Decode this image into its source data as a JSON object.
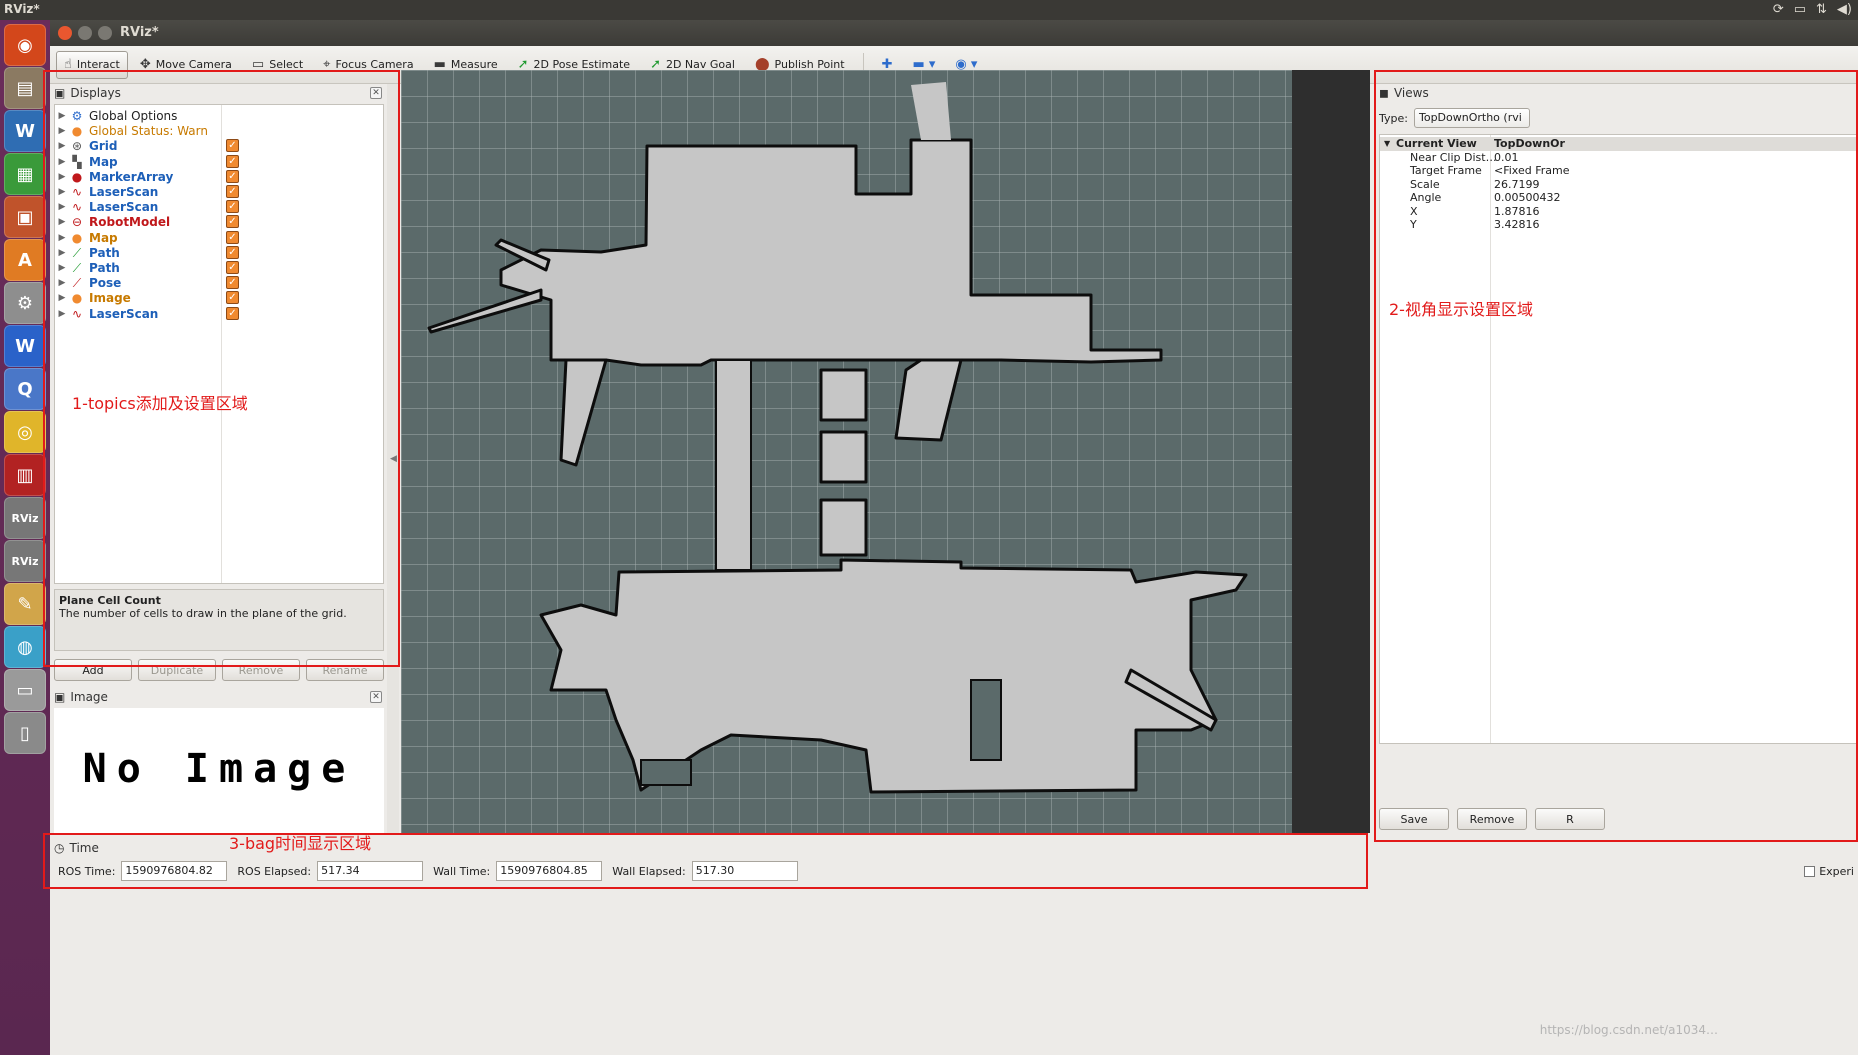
{
  "os": {
    "topbar_title": "RViz*",
    "tray": [
      "tray-update-icon",
      "tray-keyboard-icon",
      "tray-network-icon",
      "tray-volume-icon"
    ]
  },
  "launcher": [
    {
      "name": "ubuntu-dash-icon",
      "glyph": "◉",
      "color": "#d3471b"
    },
    {
      "name": "files-icon",
      "glyph": "▤",
      "color": "#8b7a62"
    },
    {
      "name": "writer-icon",
      "glyph": "W",
      "color": "#2f6db3"
    },
    {
      "name": "calc-icon",
      "glyph": "▦",
      "color": "#3a9a3a"
    },
    {
      "name": "impress-icon",
      "glyph": "▣",
      "color": "#c0532b"
    },
    {
      "name": "software-center-icon",
      "glyph": "A",
      "color": "#e07b23"
    },
    {
      "name": "settings-icon",
      "glyph": "⚙",
      "color": "#8e8e8e"
    },
    {
      "name": "wps-icon",
      "glyph": "W",
      "color": "#2a62c9"
    },
    {
      "name": "search-tool-icon",
      "glyph": "Q",
      "color": "#4a77c8"
    },
    {
      "name": "chrome-icon",
      "glyph": "◎",
      "color": "#e0b52a"
    },
    {
      "name": "media-icon",
      "glyph": "▥",
      "color": "#b22222"
    },
    {
      "name": "rviz-icon-1",
      "glyph": "RViz",
      "color": "#777"
    },
    {
      "name": "rviz-icon-2",
      "glyph": "RViz",
      "color": "#777"
    },
    {
      "name": "paint-icon",
      "glyph": "✎",
      "color": "#d1a54a"
    },
    {
      "name": "chat-icon",
      "glyph": "◍",
      "color": "#3aa0c8"
    },
    {
      "name": "drive-icon",
      "glyph": "▭",
      "color": "#9a9a9a"
    },
    {
      "name": "trash-icon",
      "glyph": "▯",
      "color": "#8a8a8a"
    }
  ],
  "window": {
    "title": "RViz*"
  },
  "toolbar": {
    "tools": [
      {
        "name": "interact",
        "label": "Interact",
        "icon": "hand-icon",
        "glyph": "☝",
        "active": true,
        "cls": ""
      },
      {
        "name": "move-camera",
        "label": "Move Camera",
        "icon": "move-icon",
        "glyph": "✥",
        "active": false,
        "cls": ""
      },
      {
        "name": "select",
        "label": "Select",
        "icon": "select-icon",
        "glyph": "▭",
        "active": false,
        "cls": ""
      },
      {
        "name": "focus-camera",
        "label": "Focus Camera",
        "icon": "focus-icon",
        "glyph": "⌖",
        "active": false,
        "cls": ""
      },
      {
        "name": "measure",
        "label": "Measure",
        "icon": "ruler-icon",
        "glyph": "▬",
        "active": false,
        "cls": ""
      },
      {
        "name": "2d-pose-estimate",
        "label": "2D Pose Estimate",
        "icon": "pose-arrow-icon",
        "glyph": "➚",
        "active": false,
        "cls": "green"
      },
      {
        "name": "2d-nav-goal",
        "label": "2D Nav Goal",
        "icon": "goal-arrow-icon",
        "glyph": "➚",
        "active": false,
        "cls": "green"
      },
      {
        "name": "publish-point",
        "label": "Publish Point",
        "icon": "pin-icon",
        "glyph": "⬤",
        "active": false,
        "cls": "brown"
      }
    ],
    "extra": [
      {
        "name": "add-tool-icon",
        "glyph": "✚"
      },
      {
        "name": "remove-tool-icon",
        "glyph": "▬ ▾"
      },
      {
        "name": "eye-icon",
        "glyph": "◉ ▾"
      }
    ]
  },
  "displays": {
    "title": "Displays",
    "items": [
      {
        "label": "Global Options",
        "cls": "plain",
        "icon": "gear-icon",
        "glyph": "⚙",
        "icolor": "#2d6ccc",
        "checked": false
      },
      {
        "label": "Global Status: Warn",
        "cls": "warn",
        "icon": "warning-icon",
        "glyph": "●",
        "icolor": "#f08a30",
        "checked": false
      },
      {
        "label": "Grid",
        "cls": "",
        "icon": "grid-icon",
        "glyph": "⊛",
        "icolor": "#555",
        "checked": true
      },
      {
        "label": "Map",
        "cls": "",
        "icon": "map-icon",
        "glyph": "▚",
        "icolor": "#555",
        "checked": true
      },
      {
        "label": "MarkerArray",
        "cls": "",
        "icon": "marker-icon",
        "glyph": "●",
        "icolor": "#c0181b",
        "checked": true
      },
      {
        "label": "LaserScan",
        "cls": "",
        "icon": "laser-icon",
        "glyph": "∿",
        "icolor": "#c0181b",
        "checked": true
      },
      {
        "label": "LaserScan",
        "cls": "",
        "icon": "laser-icon",
        "glyph": "∿",
        "icolor": "#c0181b",
        "checked": true
      },
      {
        "label": "RobotModel",
        "cls": "err",
        "icon": "error-icon",
        "glyph": "⊖",
        "icolor": "#c0181b",
        "checked": true
      },
      {
        "label": "Map",
        "cls": "warnb",
        "icon": "warning-icon",
        "glyph": "●",
        "icolor": "#f08a30",
        "checked": true
      },
      {
        "label": "Path",
        "cls": "",
        "icon": "path-icon",
        "glyph": "⟋",
        "icolor": "#1f9a2f",
        "checked": true
      },
      {
        "label": "Path",
        "cls": "",
        "icon": "path-icon",
        "glyph": "⟋",
        "icolor": "#1f9a2f",
        "checked": true
      },
      {
        "label": "Pose",
        "cls": "",
        "icon": "pose-icon",
        "glyph": "⟋",
        "icolor": "#c0181b",
        "checked": true
      },
      {
        "label": "Image",
        "cls": "warnb",
        "icon": "warning-icon",
        "glyph": "●",
        "icolor": "#f08a30",
        "checked": true
      },
      {
        "label": "LaserScan",
        "cls": "",
        "icon": "laser-icon",
        "glyph": "∿",
        "icolor": "#c0181b",
        "checked": true
      }
    ],
    "desc_title": "Plane Cell Count",
    "desc_text": "The number of cells to draw in the plane of the grid.",
    "buttons": {
      "add": "Add",
      "duplicate": "Duplicate",
      "remove": "Remove",
      "rename": "Rename"
    }
  },
  "image_panel": {
    "title": "Image",
    "no_image": "No Image"
  },
  "views": {
    "title": "Views",
    "type_label": "Type:",
    "type_value": "TopDownOrtho (rvi",
    "rows": [
      {
        "k": "Current View",
        "v": "TopDownOr",
        "head": true
      },
      {
        "k": "Near Clip Dist…",
        "v": "0.01",
        "head": false
      },
      {
        "k": "Target Frame",
        "v": "<Fixed Frame",
        "head": false
      },
      {
        "k": "Scale",
        "v": "26.7199",
        "head": false
      },
      {
        "k": "Angle",
        "v": "0.00500432",
        "head": false
      },
      {
        "k": "X",
        "v": "1.87816",
        "head": false
      },
      {
        "k": "Y",
        "v": "3.42816",
        "head": false
      }
    ],
    "save": "Save",
    "remove": "Remove",
    "r": "R"
  },
  "time": {
    "title": "Time",
    "ros_time_label": "ROS Time:",
    "ros_time": "1590976804.82",
    "ros_elapsed_label": "ROS Elapsed:",
    "ros_elapsed": "517.34",
    "wall_time_label": "Wall Time:",
    "wall_time": "1590976804.85",
    "wall_elapsed_label": "Wall Elapsed:",
    "wall_elapsed": "517.30",
    "experimental": "Experi"
  },
  "annotations": {
    "a1": "1-topics添加及设置区域",
    "a2": "2-视角显示设置区域",
    "a3": "3-bag时间显示区域"
  },
  "watermark": "https://blog.csdn.net/a1034…"
}
